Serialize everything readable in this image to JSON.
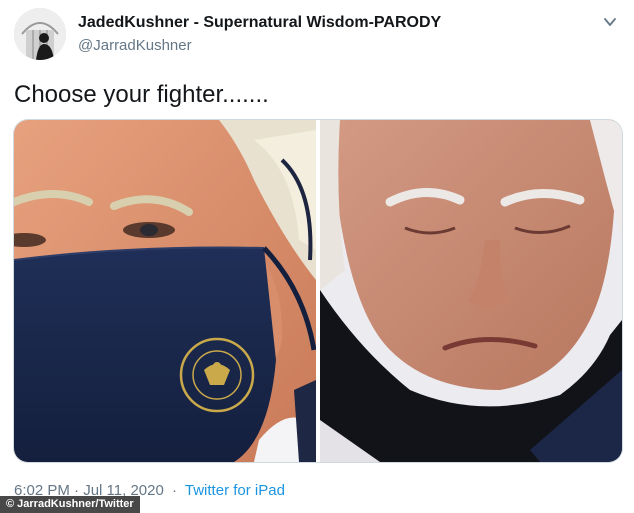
{
  "tweet": {
    "display_name": "JadedKushner - Supernatural Wisdom-PARODY",
    "handle": "@JarradKushner",
    "text": "Choose your fighter.......",
    "time": "6:02 PM · Jul 11, 2020",
    "separator": "·",
    "source": "Twitter for iPad"
  },
  "media": {
    "photos": [
      {
        "name": "man-in-navy-seal-mask-photo"
      },
      {
        "name": "man-with-lowered-black-mask-photo"
      }
    ],
    "seal_color": "#c9a94a",
    "mask_color": "#1c2a4e"
  },
  "photo_credit": "© JarradKushner/Twitter",
  "colors": {
    "text": "#14171a",
    "secondary_text": "#657786",
    "link": "#1b95e0",
    "background": "#ffffff"
  },
  "icons": {
    "avatar": "avatar-silhouette-icon",
    "menu": "chevron-down-icon"
  }
}
